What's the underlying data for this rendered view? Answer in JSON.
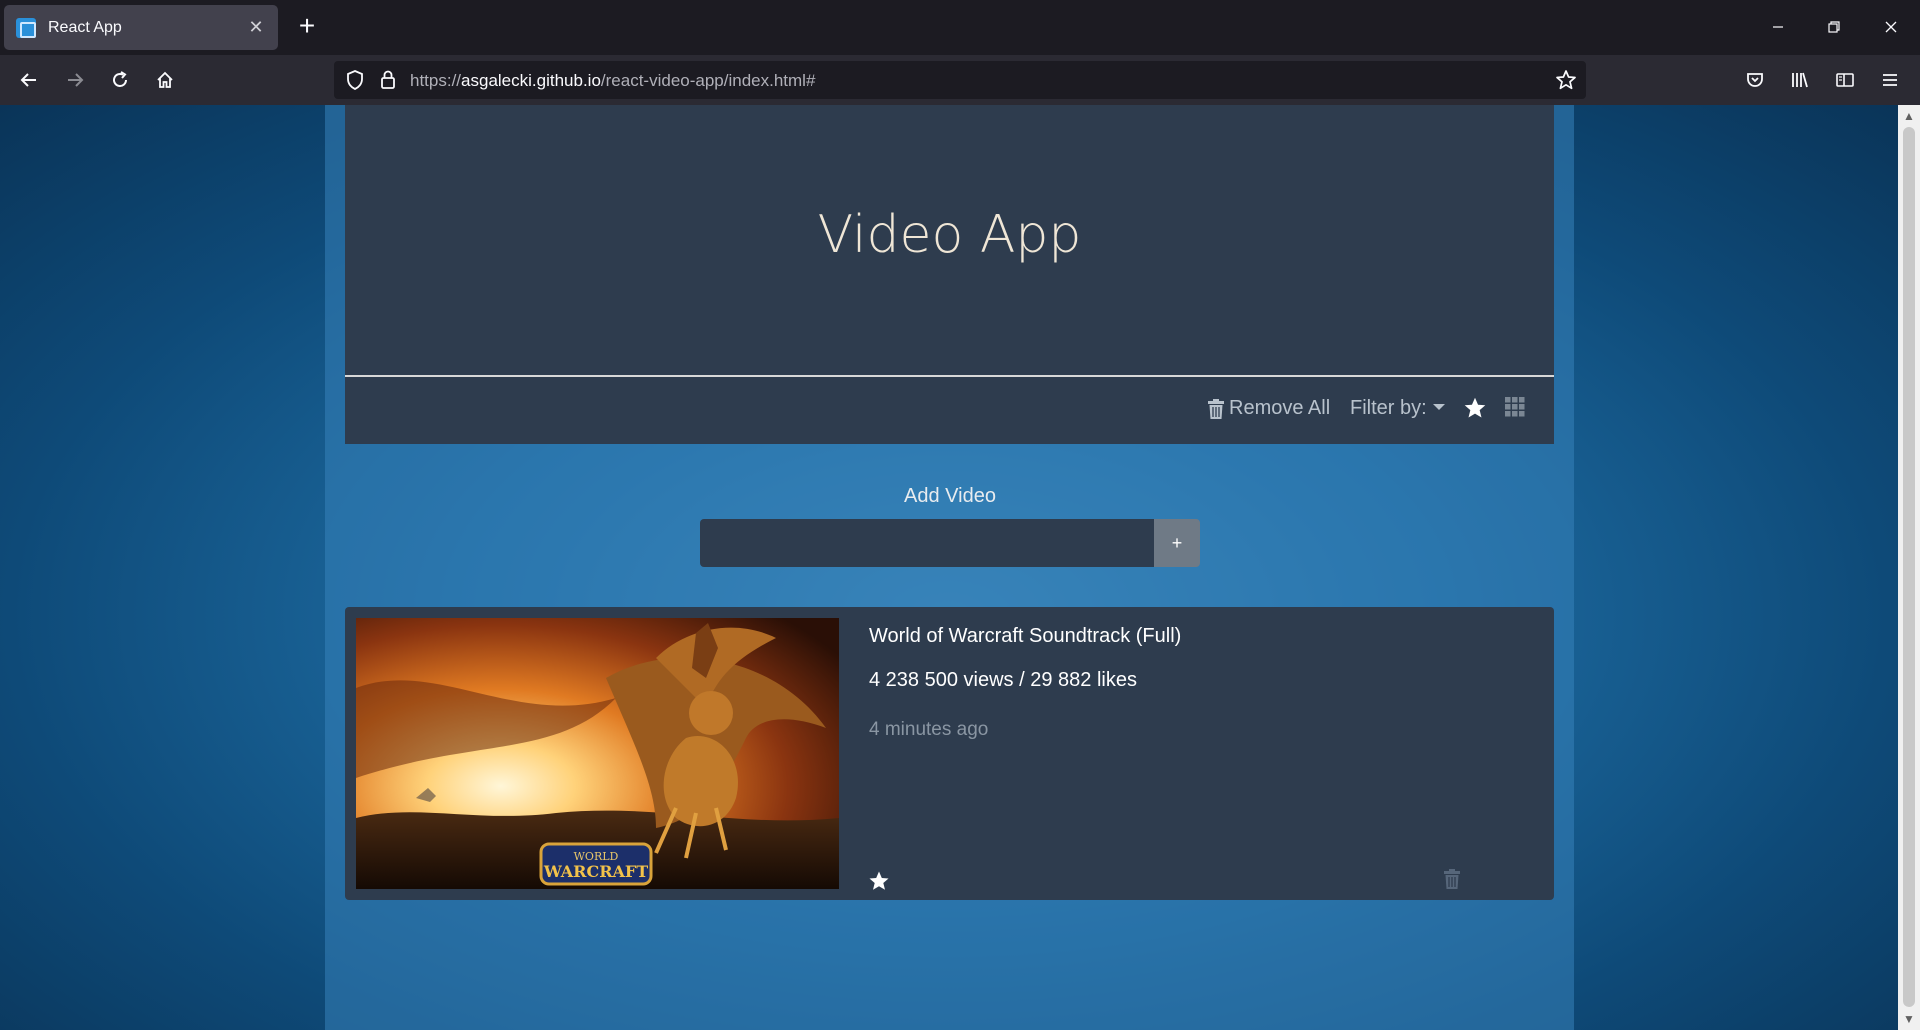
{
  "browser": {
    "tab_title": "React App",
    "url_prefix": "https://",
    "url_host": "asgalecki.github.io",
    "url_path": "/react-video-app/index.html#"
  },
  "app": {
    "title": "Video App",
    "toolbar": {
      "remove_all_label": "Remove All",
      "filter_label": "Filter by:"
    },
    "add_video": {
      "label": "Add Video",
      "input_value": "",
      "button_label": "+"
    },
    "videos": [
      {
        "title": "World of Warcraft Soundtrack (Full)",
        "stats": "4 238 500 views / 29 882 likes",
        "added": "4 minutes ago",
        "thumbnail_logo_line1": "WORLD",
        "thumbnail_logo_line2": "WARCRAFT"
      }
    ]
  },
  "colors": {
    "accent_star": "#ffffff",
    "panel": "#2e3c4e",
    "title_text": "#efe6d6"
  },
  "icons": [
    "favicon-icon",
    "close-icon",
    "plus-icon",
    "minimize-icon",
    "restore-icon",
    "back-icon",
    "forward-icon",
    "reload-icon",
    "home-icon",
    "shield-icon",
    "lock-icon",
    "bookmark-star-icon",
    "pocket-icon",
    "library-icon",
    "sidebar-icon",
    "menu-icon",
    "trash-icon",
    "star-icon",
    "grid-icon"
  ]
}
